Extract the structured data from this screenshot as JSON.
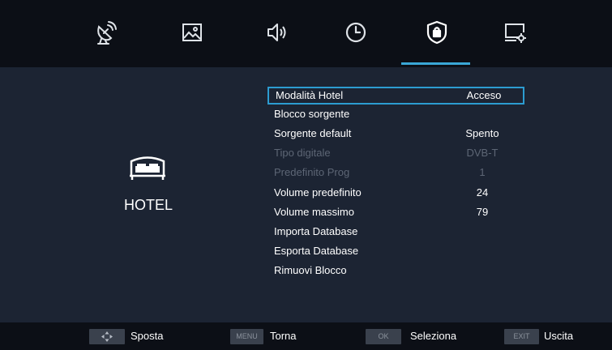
{
  "tabs": [
    {
      "icon": "satellite-dish-icon"
    },
    {
      "icon": "picture-icon"
    },
    {
      "icon": "speaker-icon"
    },
    {
      "icon": "clock-icon"
    },
    {
      "icon": "lock-shield-icon",
      "active": true
    },
    {
      "icon": "monitor-settings-icon"
    }
  ],
  "side": {
    "icon": "bed-icon",
    "title": "HOTEL"
  },
  "menu": [
    {
      "label": "Modalità Hotel",
      "value": "Acceso",
      "state": "selected"
    },
    {
      "label": "Blocco sorgente",
      "value": "",
      "state": "normal"
    },
    {
      "label": "Sorgente default",
      "value": "Spento",
      "state": "normal"
    },
    {
      "label": "Tipo digitale",
      "value": "DVB-T",
      "state": "disabled"
    },
    {
      "label": "Predefinito Prog",
      "value": "1",
      "state": "disabled"
    },
    {
      "label": "Volume predefinito",
      "value": "24",
      "state": "normal"
    },
    {
      "label": "Volume massimo",
      "value": "79",
      "state": "normal"
    },
    {
      "label": "Importa Database",
      "value": "",
      "state": "normal"
    },
    {
      "label": "Esporta Database",
      "value": "",
      "state": "normal"
    },
    {
      "label": "Rimuovi Blocco",
      "value": "",
      "state": "normal"
    }
  ],
  "footer": {
    "move_label": "Sposta",
    "menu_key": "MENU",
    "menu_label": "Torna",
    "ok_key": "OK",
    "ok_label": "Seleziona",
    "exit_key": "EXIT",
    "exit_label": "Uscita"
  },
  "colors": {
    "accent": "#2c9cd1",
    "background": "#1c2433",
    "bar": "#0c0f16"
  }
}
